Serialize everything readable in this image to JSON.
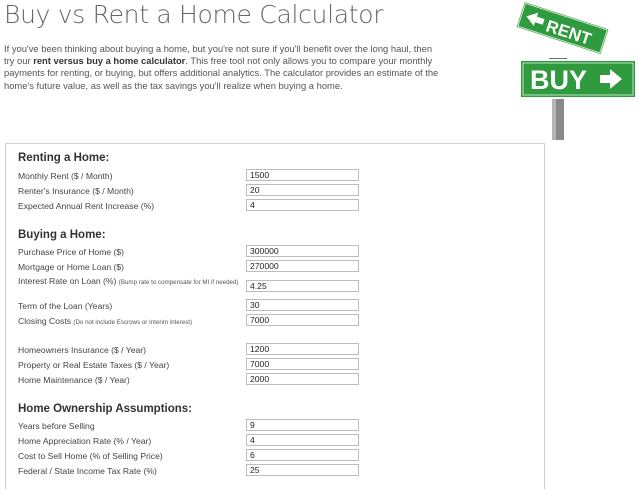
{
  "page": {
    "title": "Buy vs Rent a Home Calculator",
    "intro": {
      "part1": "If you've been thinking about buying a home, but you're not sure if you'll benefit over the long haul, then try our ",
      "bold": "rent versus buy a home calculator",
      "part2": ".  This free tool not only allows you to compare your monthly payments for renting, or buying, but offers additional analytics.  The calculator provides an estimate of the home's future value, as well as the tax savings you'll realize when buying a home."
    },
    "signpost": {
      "rent_label": "RENT",
      "buy_label": "BUY",
      "colors": {
        "sign_green": "#2f9a3e",
        "post": "#8a8a8a"
      }
    }
  },
  "renting": {
    "heading": "Renting a Home:",
    "fields": [
      {
        "label": "Monthly Rent ($ / Month)",
        "value": "1500"
      },
      {
        "label": "Renter's Insurance ($ / Month)",
        "value": "20"
      },
      {
        "label": "Expected Annual Rent Increase (%)",
        "value": "4"
      }
    ]
  },
  "buying": {
    "heading": "Buying a Home:",
    "fields": [
      {
        "label": "Purchase Price of Home ($)",
        "value": "300000"
      },
      {
        "label": "Mortgage or Home Loan ($)",
        "value": "270000"
      },
      {
        "label": "Interest Rate on Loan (%)",
        "note": "(Bump rate to compensate for MI if needed)",
        "value": "4.25"
      },
      {
        "label": "Term of the Loan (Years)",
        "value": "30"
      },
      {
        "label": "Closing Costs",
        "note": "(Do not include Escrows or Interim interest)",
        "value": "7000"
      },
      {
        "label": "Homeowners Insurance ($ / Year)",
        "value": "1200"
      },
      {
        "label": "Property or Real Estate Taxes ($ / Year)",
        "value": "7000"
      },
      {
        "label": "Home Maintenance ($ / Year)",
        "value": "2000"
      }
    ]
  },
  "ownership": {
    "heading": "Home Ownership Assumptions:",
    "fields": [
      {
        "label": "Years before Selling",
        "value": "9"
      },
      {
        "label": "Home Appreciation Rate (% / Year)",
        "value": "4"
      },
      {
        "label": "Cost to Sell Home (% of Selling Price)",
        "value": "6"
      },
      {
        "label": "Federal / State Income Tax Rate (%)",
        "value": "25"
      }
    ]
  }
}
